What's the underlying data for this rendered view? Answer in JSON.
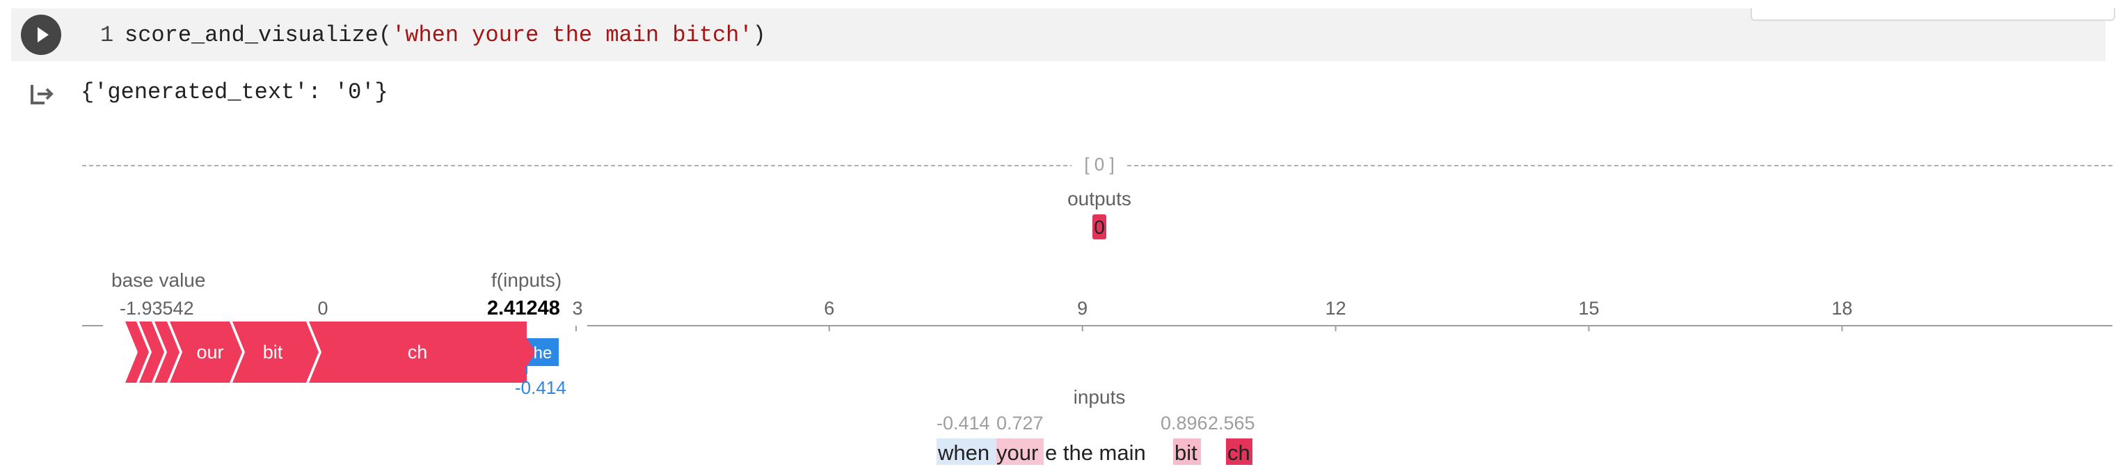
{
  "cell": {
    "line_number": "1",
    "code_function": "score_and_visualize(",
    "code_string": "'when youre the main bitch'",
    "code_close": ")"
  },
  "output": {
    "generated_text": "{'generated_text': '0'}"
  },
  "visualization": {
    "output_label": "[ 0 ]",
    "outputs_title": "outputs",
    "output_token": "0",
    "base_value_label": "base value",
    "base_value": "-1.93542",
    "f_inputs_label": "f(inputs)",
    "f_inputs_value": "2.41248",
    "axis_ticks": [
      "0",
      "3",
      "6",
      "9",
      "12",
      "15",
      "18"
    ],
    "positive_segments": [
      "our",
      "bit",
      "ch"
    ],
    "negative_segment": "he",
    "negative_value": "-0.414",
    "inputs_title": "inputs",
    "input_values": [
      "-0.414",
      "0.727",
      "0.896",
      "2.565"
    ],
    "tokens": [
      "when",
      "your",
      "e the main",
      "bit",
      "ch"
    ],
    "colors": {
      "positive": "#ef3a5c",
      "negative": "#2b88e6",
      "axis": "#9e9e9e",
      "token_when": "#dbe8f8",
      "token_your": "#f6c7d2",
      "token_bit": "#f7bccb",
      "token_ch": "#e4335a"
    }
  }
}
